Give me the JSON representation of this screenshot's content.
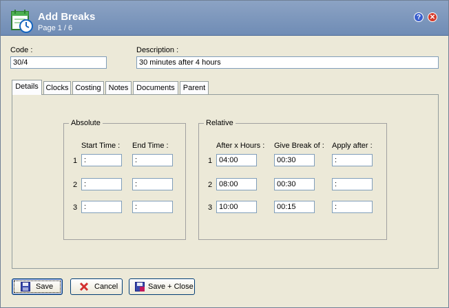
{
  "window": {
    "title": "Add Breaks",
    "subtitle": "Page 1 / 6"
  },
  "fields": {
    "code_label": "Code :",
    "code_value": "30/4",
    "description_label": "Description :",
    "description_value": "30 minutes after 4 hours"
  },
  "tabs": [
    "Details",
    "Clocks",
    "Costing",
    "Notes",
    "Documents",
    "Parent"
  ],
  "absolute": {
    "title": "Absolute",
    "headers": [
      "Start Time :",
      "End Time :"
    ],
    "rows": [
      {
        "num": "1",
        "start": " :",
        "end": " :"
      },
      {
        "num": "2",
        "start": " :",
        "end": " :"
      },
      {
        "num": "3",
        "start": " :",
        "end": " :"
      }
    ]
  },
  "relative": {
    "title": "Relative",
    "headers": [
      "After x Hours :",
      "Give Break of :",
      "Apply after :"
    ],
    "rows": [
      {
        "num": "1",
        "after": "04:00",
        "give": "00:30",
        "apply": " :"
      },
      {
        "num": "2",
        "after": "08:00",
        "give": "00:30",
        "apply": " :"
      },
      {
        "num": "3",
        "after": "10:00",
        "give": "00:15",
        "apply": " :"
      }
    ]
  },
  "buttons": {
    "save": "Save",
    "cancel": "Cancel",
    "save_close": "Save + Close"
  }
}
